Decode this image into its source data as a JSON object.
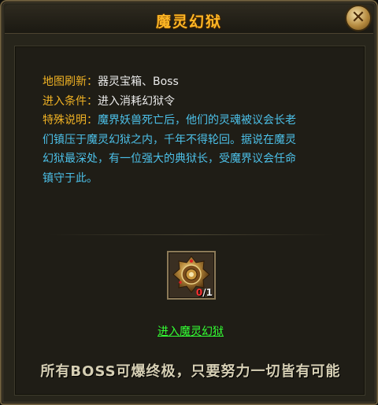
{
  "window": {
    "title": "魔灵幻狱",
    "close_icon": "close-icon"
  },
  "info": {
    "map_refresh_label": "地图刷新：",
    "map_refresh_value": "器灵宝箱、Boss",
    "entry_label": "进入条件：",
    "entry_value": "进入消耗幻狱令",
    "special_label": "特殊说明：",
    "special_lines": [
      "魔界妖兽死亡后，他们的灵魂被议会长老",
      "们镇压于魔灵幻狱之内，千年不得轮回。据说在魔灵",
      "幻狱最深处，有一位强大的典狱长，受魔界议会任命",
      "镇守于此。"
    ]
  },
  "item": {
    "icon": "ornate-medallion-icon",
    "count_have": "0",
    "count_sep": "/",
    "count_need": "1"
  },
  "enter_link": "进入魔灵幻狱",
  "slogan": "所有BOSS可爆终极，只要努力一切皆有可能",
  "colors": {
    "title": "#ffb624",
    "label": "#f0b224",
    "description": "#4cc0e8",
    "link": "#33ff33",
    "count_have": "#ff3030"
  }
}
